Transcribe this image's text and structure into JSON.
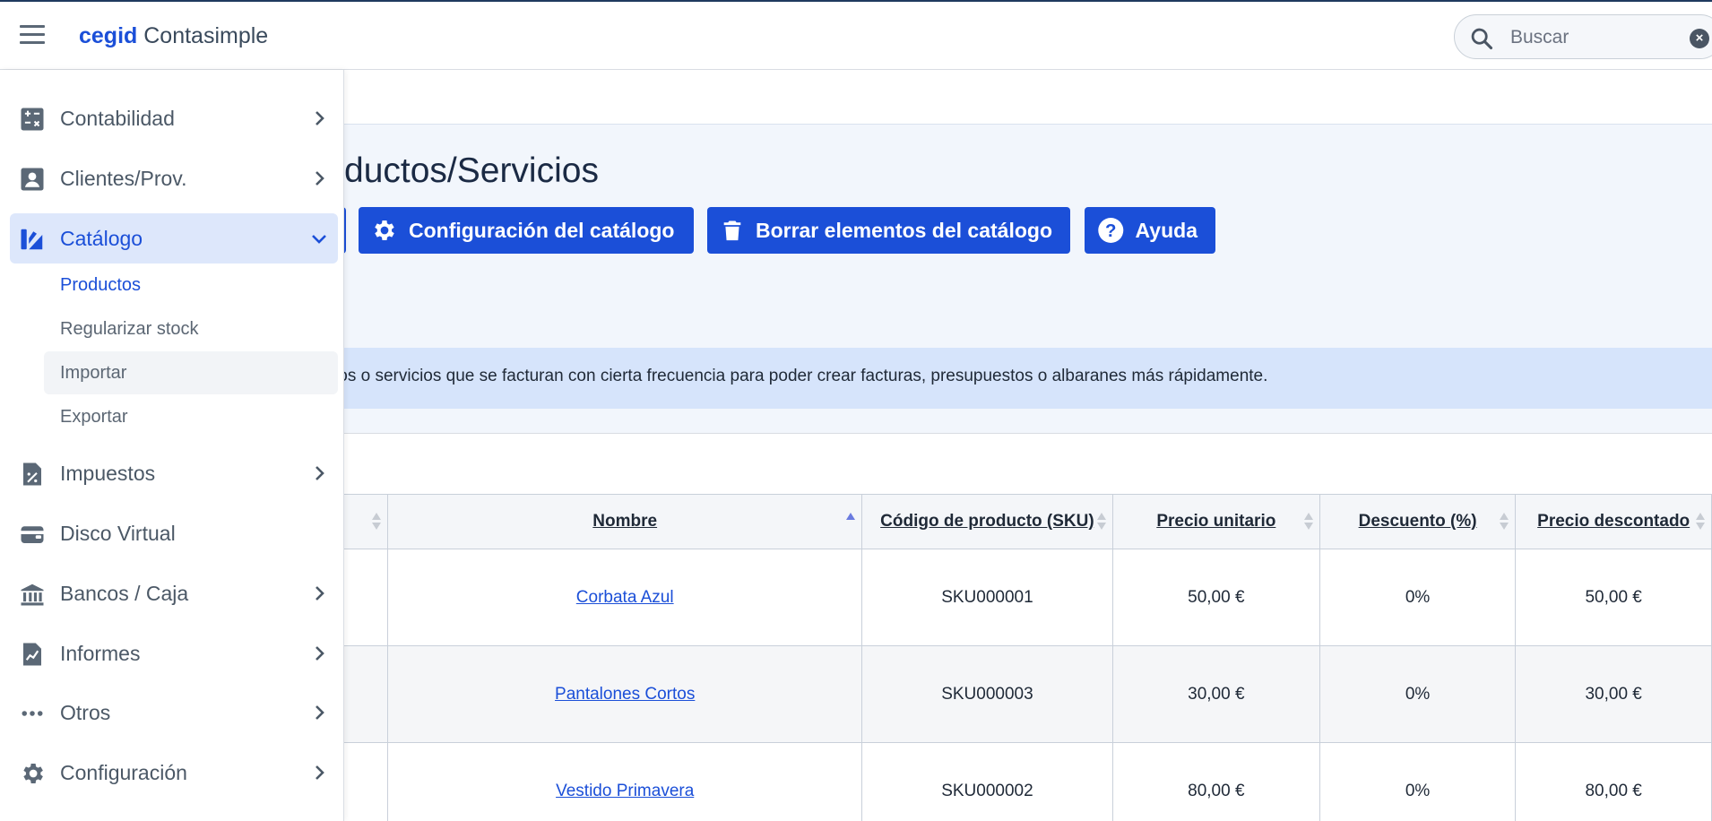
{
  "app": {
    "brand_bold": "cegid",
    "brand_rest": "Contasimple"
  },
  "search": {
    "placeholder": "Buscar",
    "value": ""
  },
  "page": {
    "title": "ductos/Servicios",
    "info": "tos o servicios que se facturan con cierta frecuencia para poder crear facturas, presupuestos o albaranes más rápidamente."
  },
  "toolbar": {
    "config_label": "Configuración del catálogo",
    "borrar_label": "Borrar elementos del catálogo",
    "ayuda_label": "Ayuda"
  },
  "sidebar": {
    "items": [
      {
        "label": "Contabilidad",
        "icon": "calculator-icon"
      },
      {
        "label": "Clientes/Prov.",
        "icon": "contact-icon"
      },
      {
        "label": "Catálogo",
        "icon": "catalog-icon",
        "expanded": true
      },
      {
        "label": "Impuestos",
        "icon": "tax-document-icon"
      },
      {
        "label": "Disco Virtual",
        "icon": "wallet-icon"
      },
      {
        "label": "Bancos / Caja",
        "icon": "bank-icon"
      },
      {
        "label": "Informes",
        "icon": "report-icon"
      },
      {
        "label": "Otros",
        "icon": "more-dots-icon"
      },
      {
        "label": "Configuración",
        "icon": "gear-icon"
      }
    ],
    "catalog_sub": [
      {
        "label": "Productos"
      },
      {
        "label": "Regularizar stock"
      },
      {
        "label": "Importar"
      },
      {
        "label": "Exportar"
      }
    ]
  },
  "table": {
    "columns": [
      {
        "label": "Nombre"
      },
      {
        "label": "Código de producto (SKU)"
      },
      {
        "label": "Precio unitario"
      },
      {
        "label": "Descuento (%)"
      },
      {
        "label": "Precio descontado"
      }
    ],
    "rows": [
      {
        "nombre": "Corbata Azul",
        "sku": "SKU000001",
        "precio": "50,00 €",
        "descuento": "0%",
        "descontado": "50,00 €"
      },
      {
        "nombre": "Pantalones Cortos",
        "sku": "SKU000003",
        "precio": "30,00 €",
        "descuento": "0%",
        "descontado": "30,00 €"
      },
      {
        "nombre": "Vestido Primavera",
        "sku": "SKU000002",
        "precio": "80,00 €",
        "descuento": "0%",
        "descontado": "80,00 €"
      }
    ]
  },
  "colors": {
    "accent": "#1b4fd8",
    "hero_bg": "#f2f6fc",
    "info_bg": "#d6e4fb",
    "active_nav_bg": "#dde7fb"
  }
}
